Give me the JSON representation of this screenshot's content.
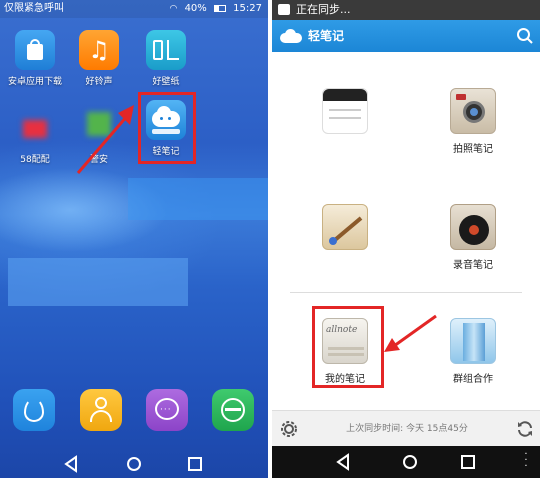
{
  "left": {
    "status": {
      "carrier": "仅限紧急呼叫",
      "battery": "40%",
      "time": "15:27"
    },
    "apps": [
      {
        "label": "安卓应用下载",
        "icon": "shopping-bag-icon",
        "color": "#2c8fe6"
      },
      {
        "label": "好铃声",
        "icon": "music-note-icon",
        "color": "#ff8a00"
      },
      {
        "label": "好壁纸",
        "icon": "wallpaper-icon",
        "color": "#2fb5d8"
      },
      {
        "label": "58配配",
        "icon": "pixel-icon",
        "color": "#e83040"
      },
      {
        "label": "警安",
        "icon": "pixel-icon",
        "color": "#53b44b"
      },
      {
        "label": "轻笔记",
        "icon": "cloud-note-icon",
        "color": "#2a8ee0"
      }
    ],
    "dock": [
      {
        "icon": "phone-icon",
        "color": "#1f8ee8"
      },
      {
        "icon": "contacts-icon",
        "color": "#f1b21d"
      },
      {
        "icon": "message-icon",
        "color": "#9a53d1"
      },
      {
        "icon": "browser-icon",
        "color": "#2ab05a"
      }
    ]
  },
  "right": {
    "status": {
      "text": "正在同步..."
    },
    "appbar": {
      "title": "轻笔记"
    },
    "grid": [
      {
        "label": "",
        "icon": "notebook-icon"
      },
      {
        "label": "拍照笔记",
        "icon": "camera-icon"
      },
      {
        "label": "",
        "icon": "paint-brush-icon"
      },
      {
        "label": "录音笔记",
        "icon": "record-icon"
      },
      {
        "label": "我的笔记",
        "icon": "my-notes-icon",
        "sublabel": "allnote"
      },
      {
        "label": "群组合作",
        "icon": "group-cooperate-icon"
      }
    ],
    "footer": {
      "sync_text": "上次同步时间: 今天 15点45分"
    }
  },
  "colors": {
    "highlight": "#e32626",
    "appbar": "#1c86d6"
  }
}
